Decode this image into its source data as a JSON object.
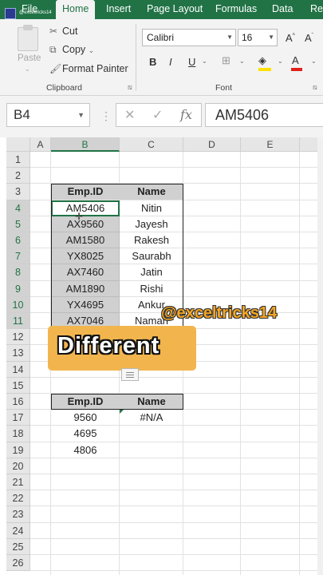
{
  "ribbon_tabs": [
    "File",
    "Home",
    "Insert",
    "Page Layout",
    "Formulas",
    "Data",
    "Re"
  ],
  "active_tab": "Home",
  "clipboard": {
    "paste": "Paste",
    "cut": "Cut",
    "copy": "Copy",
    "format_painter": "Format Painter",
    "group_label": "Clipboard"
  },
  "font": {
    "name": "Calibri",
    "size": "16",
    "group_label": "Font",
    "bold": "B",
    "italic": "I",
    "underline": "U"
  },
  "formula_bar": {
    "name_box": "B4",
    "formula": "AM5406",
    "fx": "fx"
  },
  "columns": [
    "A",
    "B",
    "C",
    "D",
    "E"
  ],
  "rows": [
    "1",
    "2",
    "3",
    "4",
    "5",
    "6",
    "7",
    "8",
    "9",
    "10",
    "11",
    "12",
    "13",
    "14",
    "15",
    "16",
    "17",
    "18",
    "19",
    "20",
    "21",
    "22",
    "23",
    "24",
    "25",
    "26"
  ],
  "table1": {
    "headers": [
      "Emp.ID",
      "Name"
    ],
    "rows": [
      [
        "AM5406",
        "Nitin"
      ],
      [
        "AX9560",
        "Jayesh"
      ],
      [
        "AM1580",
        "Rakesh"
      ],
      [
        "YX8025",
        "Saurabh"
      ],
      [
        "AX7460",
        "Jatin"
      ],
      [
        "AM1890",
        "Rishi"
      ],
      [
        "YX4695",
        "Ankur"
      ],
      [
        "AX7046",
        "Naman"
      ]
    ]
  },
  "table2": {
    "headers": [
      "Emp.ID",
      "Name"
    ],
    "rows": [
      [
        "9560",
        "#N/A"
      ],
      [
        "4695",
        ""
      ],
      [
        "4806",
        ""
      ]
    ]
  },
  "overlay": {
    "badge_text": "Different",
    "watermark": "@exceltricks14",
    "handle": "@exceltricks14"
  },
  "colors": {
    "excel_green": "#217346",
    "badge": "#f2b54e",
    "watermark": "#f5a623"
  }
}
